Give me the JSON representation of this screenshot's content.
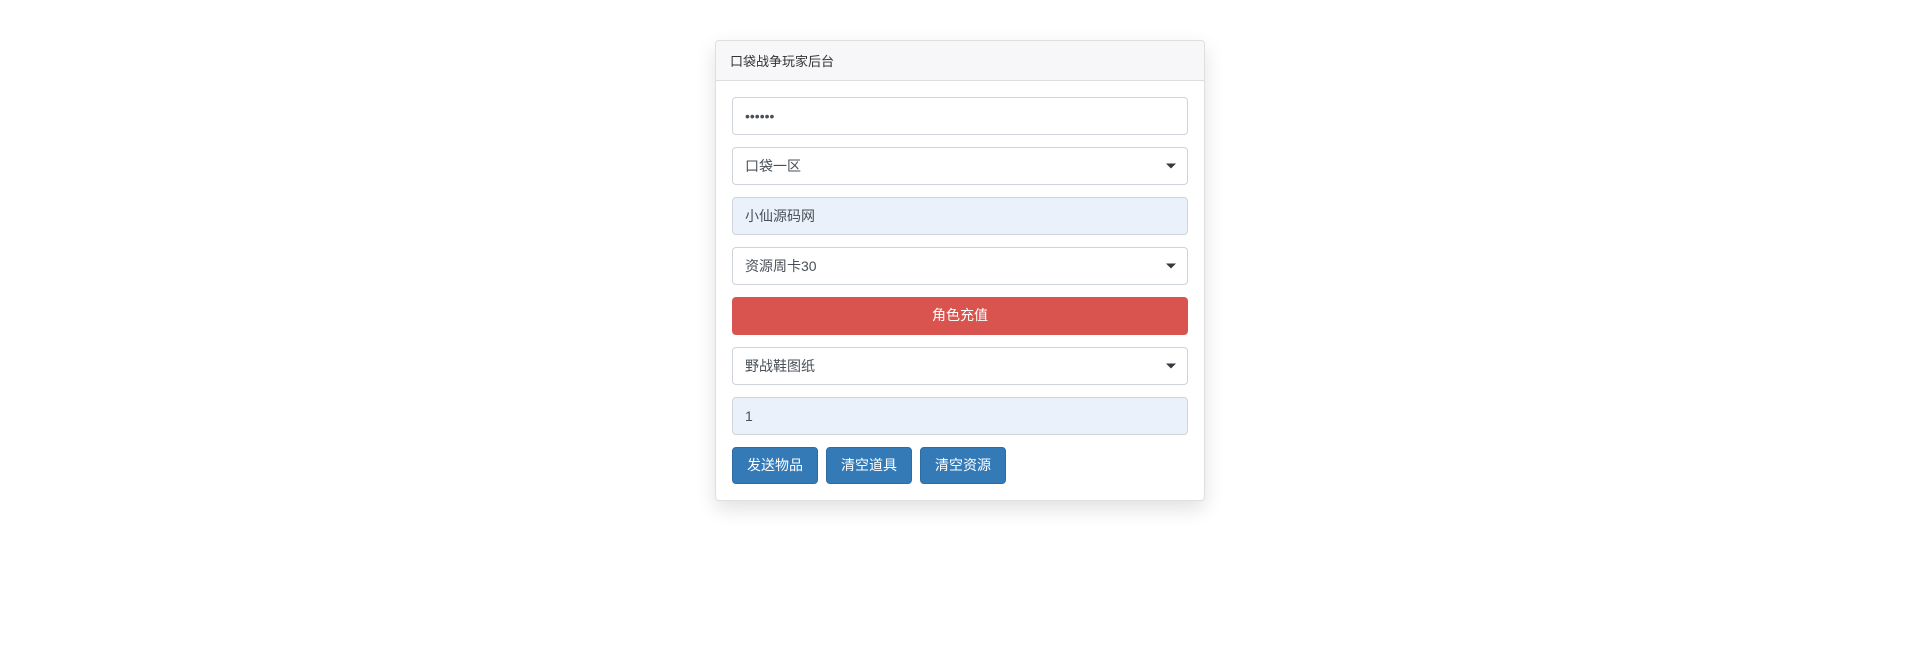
{
  "panel": {
    "title": "口袋战争玩家后台"
  },
  "form": {
    "password_value": "••••••",
    "zone_select": "口袋一区",
    "role_name_value": "小仙源码网",
    "recharge_select": "资源周卡30",
    "recharge_button_label": "角色充值",
    "item_select": "野战鞋图纸",
    "quantity_value": "1"
  },
  "buttons": {
    "send_item": "发送物品",
    "clear_items": "清空道具",
    "clear_resources": "清空资源"
  }
}
